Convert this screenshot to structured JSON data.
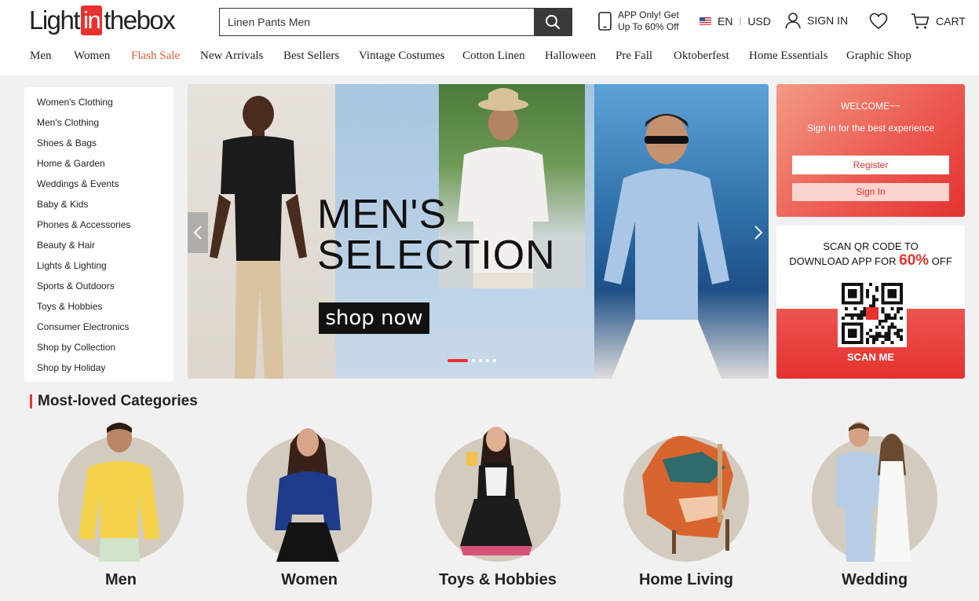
{
  "header": {
    "logo": {
      "part1": "Light",
      "part2": "in",
      "part3": "thebox"
    },
    "search": {
      "value": "Linen Pants Men"
    },
    "app_promo": {
      "line1": "APP Only! Get",
      "line2": "Up To 60% Off"
    },
    "language": "EN",
    "currency": "USD",
    "sign_in": "SIGN IN",
    "cart": "CART",
    "icons": [
      "search-icon",
      "phone-icon",
      "us-flag-icon",
      "user-icon",
      "heart-icon",
      "cart-icon"
    ]
  },
  "nav": {
    "items": [
      "Men",
      "Women",
      "Flash Sale",
      "New Arrivals",
      "Best Sellers",
      "Vintage Costumes",
      "Cotton Linen",
      "Halloween",
      "Pre Fall",
      "Oktoberfest",
      "Home Essentials",
      "Graphic Shop"
    ],
    "highlight_color": "#e25a33"
  },
  "sidebar": {
    "items": [
      "Women's Clothing",
      "Men's Clothing",
      "Shoes & Bags",
      "Home & Garden",
      "Weddings & Events",
      "Baby & Kids",
      "Phones & Accessories",
      "Beauty & Hair",
      "Lights & Lighting",
      "Sports & Outdoors",
      "Toys & Hobbies",
      "Consumer Electronics",
      "Shop by Collection",
      "Shop by Holiday"
    ]
  },
  "banner": {
    "title_line1": "MEN'S",
    "title_line2": "SELECTION",
    "cta": "shop now",
    "slides": 5,
    "active_slide": 1
  },
  "welcome": {
    "title": "WELCOME~~",
    "subtitle": "Sign in for the best experience",
    "register": "Register",
    "sign_in": "Sign In"
  },
  "qr": {
    "line1": "SCAN QR CODE TO",
    "line2_pre": "DOWNLOAD APP FOR ",
    "percent": "60%",
    "line2_post": " OFF",
    "scan_me": "SCAN ME"
  },
  "categories": {
    "title": "Most-loved Categories",
    "items": [
      "Men",
      "Women",
      "Toys & Hobbies",
      "Home Living",
      "Wedding"
    ]
  },
  "colors": {
    "brand_red": "#e8322d",
    "dark": "#3a3a3a"
  }
}
